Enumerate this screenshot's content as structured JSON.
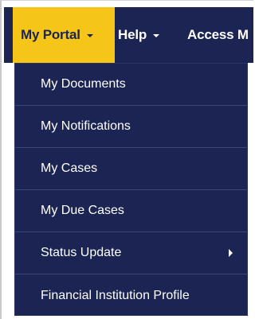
{
  "navbar": {
    "items": [
      {
        "label": "My Portal",
        "active": true,
        "has_caret": true
      },
      {
        "label": "Help",
        "active": false,
        "has_caret": true
      },
      {
        "label": "Access M",
        "active": false,
        "has_caret": false
      }
    ]
  },
  "dropdown": {
    "items": [
      {
        "label": "My Documents"
      },
      {
        "label": "My Notifications"
      },
      {
        "label": "My Cases"
      },
      {
        "label": "My Due Cases"
      },
      {
        "label": "Status Update",
        "has_submenu": true
      },
      {
        "label": "Financial Institution Profile"
      }
    ]
  },
  "colors": {
    "navbar_bg": "#1b2452",
    "active_bg": "#f5c518",
    "text": "#ffffff",
    "divider": "#3a4678"
  },
  "icons": {
    "caret": "caret-down-icon",
    "submenu": "chevron-right-icon"
  }
}
